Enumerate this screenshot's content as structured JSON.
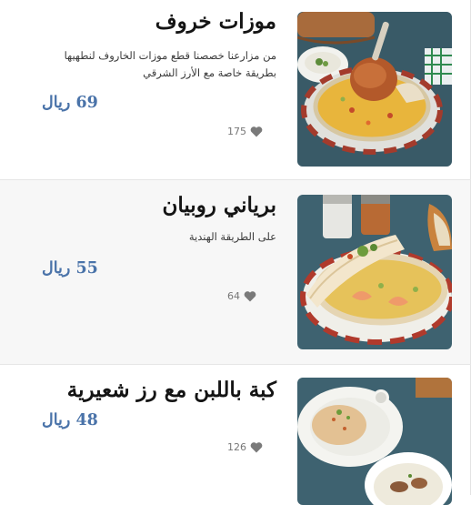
{
  "menu": {
    "items": [
      {
        "title": "موزات خروف",
        "description": "من مزارعنا خصصنا قطع موزات الخاروف لنطهيها بطريقة خاصة مع الأرز الشرقي",
        "price": "69 ريال",
        "likes": "175",
        "image_icon": "lamb-shank-rice-dish-photo"
      },
      {
        "title": "برياني روبيان",
        "description": "على الطريقة الهندية",
        "price": "55 ريال",
        "likes": "64",
        "image_icon": "shrimp-biryani-dish-photo"
      },
      {
        "title": "كبة باللبن مع رز شعيرية",
        "description": "",
        "price": "48 ريال",
        "likes": "126",
        "image_icon": "kibbeh-yogurt-vermicelli-rice-photo"
      }
    ]
  },
  "colors": {
    "price": "#4a73a9",
    "heart": "#7a7a7a",
    "alt_row": "#f7f7f7"
  }
}
